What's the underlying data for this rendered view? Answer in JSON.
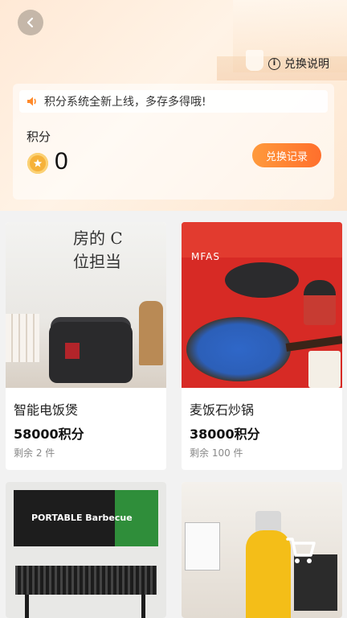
{
  "header": {
    "back_icon": "chevron-left-icon",
    "explain_label": "兑换说明",
    "explain_icon": "info-icon"
  },
  "points_card": {
    "notice_icon": "speaker-icon",
    "notice_text": "积分系统全新上线，多存多得哦!",
    "label": "积分",
    "coin_icon": "coin-star-icon",
    "value": "0",
    "record_button": "兑换记录"
  },
  "products": [
    {
      "name": "智能电饭煲",
      "price": "58000积分",
      "stock": "剩余 2 件",
      "image_text": "房的  C位担当"
    },
    {
      "name": "麦饭石炒锅",
      "price": "38000积分",
      "stock": "剩余 100 件",
      "image_text": "MFAS"
    },
    {
      "name": "",
      "price": "",
      "stock": "",
      "image_text": "PORTABLE Barbecue"
    },
    {
      "name": "",
      "price": "",
      "stock": "",
      "image_text": ""
    }
  ],
  "colors": {
    "accent_orange": "#ff7a2f",
    "coin": "#f6b23a"
  },
  "fab": {
    "icon": "shopping-cart-icon"
  }
}
